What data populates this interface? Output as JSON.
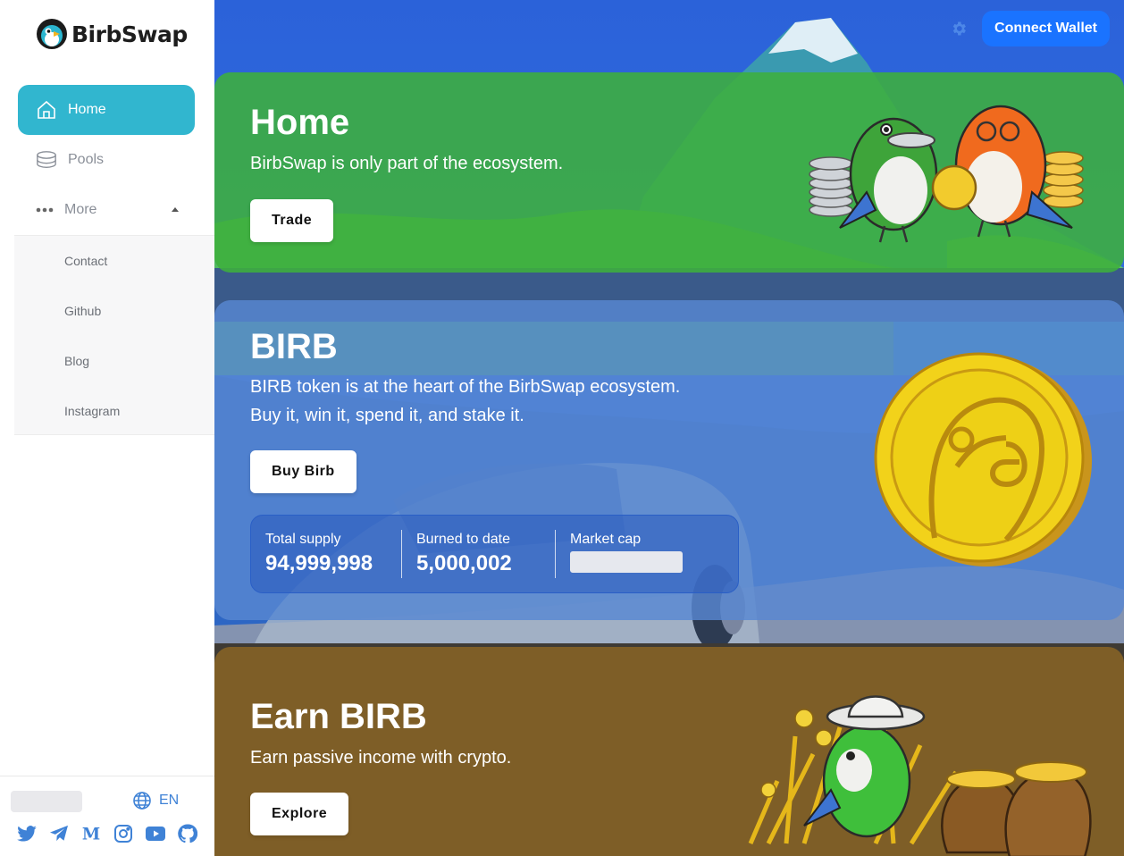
{
  "brand": {
    "name": "BirbSwap"
  },
  "sidebar": {
    "nav": [
      {
        "label": "Home",
        "icon": "home-icon",
        "active": true
      },
      {
        "label": "Pools",
        "icon": "coins-icon"
      },
      {
        "label": "More",
        "icon": "dots-icon"
      }
    ],
    "more_items": [
      "Contact",
      "Github",
      "Blog",
      "Instagram"
    ],
    "language": "EN",
    "socials": [
      "twitter-icon",
      "telegram-icon",
      "medium-icon",
      "instagram-icon",
      "youtube-icon",
      "github-icon"
    ]
  },
  "header": {
    "connect_label": "Connect Wallet"
  },
  "home_card": {
    "title": "Home",
    "text": "BirbSwap is only part of the ecosystem.",
    "button": "Trade"
  },
  "birb_card": {
    "title": "BIRB",
    "line1": "BIRB token is at the heart of the BirbSwap ecosystem.",
    "line2": "Buy it, win it, spend it, and stake it.",
    "button": "Buy Birb",
    "stats": {
      "total_supply_label": "Total supply",
      "total_supply_value": "94,999,998",
      "burned_label": "Burned to date",
      "burned_value": "5,000,002",
      "market_cap_label": "Market cap"
    }
  },
  "earn_card": {
    "title": "Earn BIRB",
    "text": "Earn passive income with crypto.",
    "button": "Explore"
  },
  "colors": {
    "accent": "#31b6cf",
    "primary_button": "#1a73ff",
    "home_card": "#3eaf3c",
    "birb_card": "#5887d2",
    "earn_card": "#8a6526"
  }
}
